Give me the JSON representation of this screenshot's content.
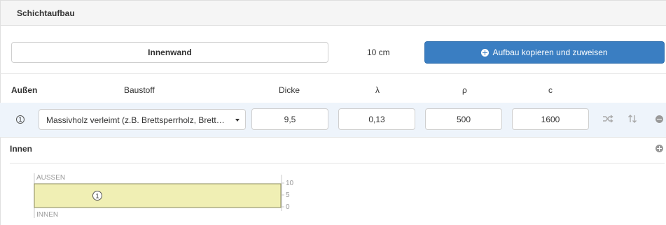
{
  "panel": {
    "title": "Schichtaufbau"
  },
  "construction": {
    "name": "Innenwand",
    "thickness": "10 cm",
    "copy_button_label": "Aufbau kopieren und zuweisen"
  },
  "table": {
    "outer_label": "Außen",
    "inner_label": "Innen",
    "columns": {
      "material": "Baustoff",
      "thickness": "Dicke",
      "lambda": "λ",
      "rho": "ρ",
      "c": "c"
    },
    "rows": [
      {
        "index": "1",
        "material": "Massivholz verleimt (z.B. Brettsperrholz, Brett…",
        "thickness": "9,5",
        "lambda": "0,13",
        "rho": "500",
        "c": "1600"
      }
    ]
  },
  "diagram": {
    "top_label": "AUSSEN",
    "bottom_label": "INNEN",
    "layer_label": "1",
    "layer_color": "#f0efb4",
    "scale_ticks": [
      "10",
      "5",
      "0"
    ]
  },
  "colors": {
    "accent": "#3a7ec2",
    "row_highlight": "#eef4fb"
  },
  "icons": {
    "copy": "plus-circle-icon",
    "shuffle": "shuffle-icon",
    "sort": "sort-icon",
    "remove": "minus-circle-icon",
    "add": "plus-circle-icon"
  }
}
